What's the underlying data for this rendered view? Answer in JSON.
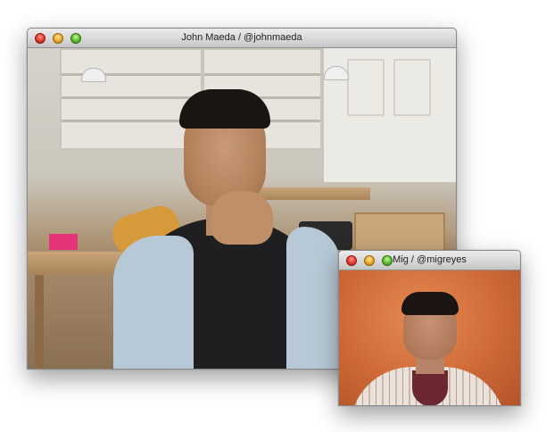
{
  "windows": {
    "main": {
      "title": "John Maeda  /  @johnmaeda"
    },
    "mig": {
      "title": "Mig  /  @migreyes"
    }
  },
  "icons": {
    "close": "close-icon",
    "minimize": "minimize-icon",
    "zoom": "zoom-icon"
  },
  "colors": {
    "close": "#e6463a",
    "minimize": "#f2b233",
    "zoom": "#6cc63a",
    "mig_background": "#cf6a36"
  }
}
